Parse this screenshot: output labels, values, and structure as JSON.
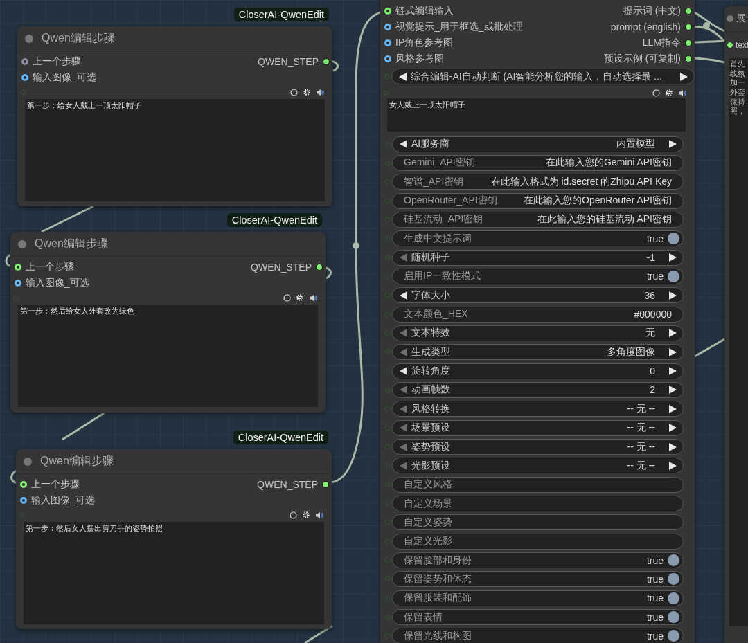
{
  "nodes": [
    {
      "badge": "CloserAI-QwenEdit",
      "title": "Qwen编辑步骤",
      "inputs": [
        {
          "label": "上一个步骤",
          "color": "#8a8a9e"
        },
        {
          "label": "输入图像_可选",
          "color": "#64b5f6"
        }
      ],
      "output": "QWEN_STEP",
      "text": "第一步：给女人戴上一顶太阳帽子"
    },
    {
      "badge": "CloserAI-QwenEdit",
      "title": "Qwen编辑步骤",
      "inputs": [
        {
          "label": "上一个步骤",
          "color": "#7cf06c"
        },
        {
          "label": "输入图像_可选",
          "color": "#64b5f6"
        }
      ],
      "output": "QWEN_STEP",
      "text": "第一步：然后给女人外套改为绿色"
    },
    {
      "badge": "CloserAI-QwenEdit",
      "title": "Qwen编辑步骤",
      "inputs": [
        {
          "label": "上一个步骤",
          "color": "#7cf06c"
        },
        {
          "label": "输入图像_可选",
          "color": "#64b5f6"
        }
      ],
      "output": "QWEN_STEP",
      "text": "第一步：然后女人摆出剪刀手的姿势拍照"
    }
  ],
  "main_node": {
    "inputs": [
      {
        "label": "链式编辑输入",
        "color": "#7cf06c"
      },
      {
        "label": "视觉提示_用于框选_或批处理",
        "color": "#64b5f6"
      },
      {
        "label": "IP角色参考图",
        "color": "#64b5f6"
      },
      {
        "label": "风格参考图",
        "color": "#64b5f6"
      }
    ],
    "outputs": [
      "提示词 (中文)",
      "prompt (english)",
      "LLM指令",
      "预设示例 (可复制)"
    ],
    "mode": {
      "kind": "combo",
      "label": "综合编辑-AI自动判断 (AI智能分析您的输入，自动选择最  ...",
      "left_enabled": true
    },
    "prompt_text": "女人戴上一顶太阳帽子",
    "widgets": [
      {
        "kind": "combo",
        "label": "AI服务商",
        "value": "内置模型",
        "left_enabled": true
      },
      {
        "kind": "text",
        "label": "Gemini_API密钥",
        "value": "在此输入您的Gemini API密钥"
      },
      {
        "kind": "text",
        "label": "智谱_API密钥",
        "value": "在此输入格式为 id.secret 的Zhipu API Key"
      },
      {
        "kind": "text",
        "label": "OpenRouter_API密钥",
        "value": "在此输入您的OpenRouter API密钥"
      },
      {
        "kind": "text",
        "label": "硅基流动_API密钥",
        "value": "在此输入您的硅基流动 API密钥"
      },
      {
        "kind": "toggle",
        "label": "生成中文提示词",
        "value": "true",
        "on": true
      },
      {
        "kind": "combo",
        "label": "随机种子",
        "value": "-1",
        "left_enabled": false
      },
      {
        "kind": "toggle",
        "label": "启用IP一致性模式",
        "value": "true",
        "on": true
      },
      {
        "kind": "combo",
        "label": "字体大小",
        "value": "36",
        "left_enabled": true
      },
      {
        "kind": "text",
        "label": "文本颜色_HEX",
        "value": "#000000"
      },
      {
        "kind": "combo",
        "label": "文本特效",
        "value": "无",
        "left_enabled": false
      },
      {
        "kind": "combo",
        "label": "生成类型",
        "value": "多角度图像",
        "left_enabled": false
      },
      {
        "kind": "combo",
        "label": "旋转角度",
        "value": "0",
        "left_enabled": true
      },
      {
        "kind": "combo",
        "label": "动画帧数",
        "value": "2",
        "left_enabled": false
      },
      {
        "kind": "combo",
        "label": "风格转换",
        "value": "-- 无 --",
        "left_enabled": false
      },
      {
        "kind": "combo",
        "label": "场景预设",
        "value": "-- 无 --",
        "left_enabled": false
      },
      {
        "kind": "combo",
        "label": "姿势预设",
        "value": "-- 无 --",
        "left_enabled": false
      },
      {
        "kind": "combo",
        "label": "光影预设",
        "value": "-- 无 --",
        "left_enabled": false
      },
      {
        "kind": "text",
        "label": "自定义风格"
      },
      {
        "kind": "text",
        "label": "自定义场景"
      },
      {
        "kind": "text",
        "label": "自定义姿势"
      },
      {
        "kind": "text",
        "label": "自定义光影"
      },
      {
        "kind": "toggle",
        "label": "保留脸部和身份",
        "value": "true",
        "on": true
      },
      {
        "kind": "toggle",
        "label": "保留姿势和体态",
        "value": "true",
        "on": true
      },
      {
        "kind": "toggle",
        "label": "保留服装和配饰",
        "value": "true",
        "on": true
      },
      {
        "kind": "toggle",
        "label": "保留表情",
        "value": "true",
        "on": true
      },
      {
        "kind": "toggle",
        "label": "保留光线和构图",
        "value": "true",
        "on": true
      }
    ]
  },
  "side_node": {
    "title": "展",
    "input": "text",
    "text_lines": [
      "首先",
      "线氛",
      "加一",
      "外套",
      "保持",
      "照，"
    ]
  }
}
